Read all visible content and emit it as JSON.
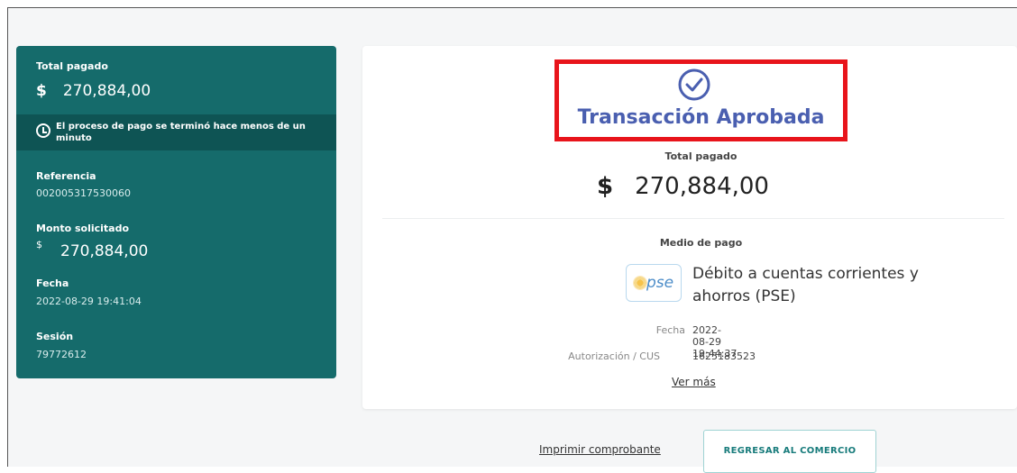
{
  "summary": {
    "total_label": "Total pagado",
    "currency": "$",
    "total_amount": "270,884,00",
    "notice_text": "El proceso de pago se terminó hace menos de un minuto",
    "reference_label": "Referencia",
    "reference_value": "002005317530060",
    "requested_label": "Monto solicitado",
    "requested_amount": "270,884,00",
    "date_label": "Fecha",
    "date_value": "2022-08-29 19:41:04",
    "session_label": "Sesión",
    "session_value": "79772612"
  },
  "card": {
    "status_icon": "check-circle-icon",
    "status_title": "Transacción Aprobada",
    "paid_label": "Total pagado",
    "currency": "$",
    "paid_amount": "270,884,00",
    "method_label": "Medio de pago",
    "method_logo_text": "pse",
    "method_name": "Débito a cuentas corrientes y ahorros (PSE)",
    "date_label": "Fecha",
    "date_value": "2022-08-29 19:44:37",
    "auth_label": "Autorización / CUS",
    "auth_value": "1625183523",
    "more_link": "Ver más"
  },
  "actions": {
    "print_label": "Imprimir comprobante",
    "back_label": "REGRESAR AL COMERCIO"
  },
  "colors": {
    "panel": "#156b6b",
    "notice": "#0e5454",
    "status": "#4a5fb0",
    "highlight": "#e8141b"
  }
}
